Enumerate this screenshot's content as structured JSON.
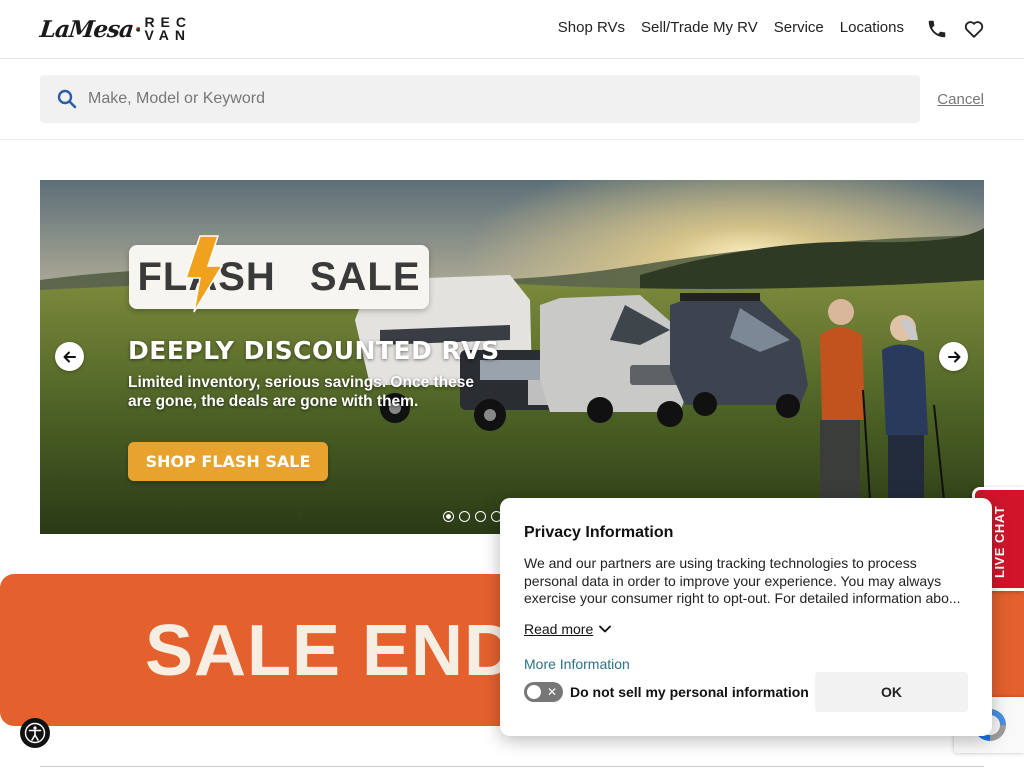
{
  "brand": {
    "logo_left": "LaMesa",
    "logo_right_top": "REC",
    "logo_right_bottom": "VAN"
  },
  "nav": {
    "items": [
      {
        "label": "Shop RVs"
      },
      {
        "label": "Sell/Trade My RV"
      },
      {
        "label": "Service"
      },
      {
        "label": "Locations"
      }
    ]
  },
  "header_icons": [
    "phone-icon",
    "heart-icon"
  ],
  "search": {
    "placeholder": "Make, Model or Keyword",
    "value": "",
    "cancel_label": "Cancel"
  },
  "hero": {
    "badge_word_1": "FLASH",
    "badge_word_2": "SALE",
    "title": "DEEPLY DISCOUNTED RVS",
    "subtitle": "Limited inventory, serious savings. Once these are gone, the deals are gone with them.",
    "cta_label": "SHOP FLASH SALE",
    "slide_count": 4,
    "active_slide": 1,
    "accent_color": "#e8a22e"
  },
  "banner": {
    "text": "SALE END",
    "color": "#e4612e"
  },
  "live_chat": {
    "label": "LIVE CHAT",
    "color": "#d0152b"
  },
  "privacy": {
    "title": "Privacy Information",
    "body_line_1": "We and our partners are using tracking technologies to process personal data in order to improve your experience. You may always",
    "body_line_2": "exercise your consumer right to opt-out. For detailed information abo...",
    "read_more_label": "Read more",
    "more_info_label": "More Information",
    "toggle_label": "Do not sell my personal information",
    "toggle_on": false,
    "ok_label": "OK"
  }
}
